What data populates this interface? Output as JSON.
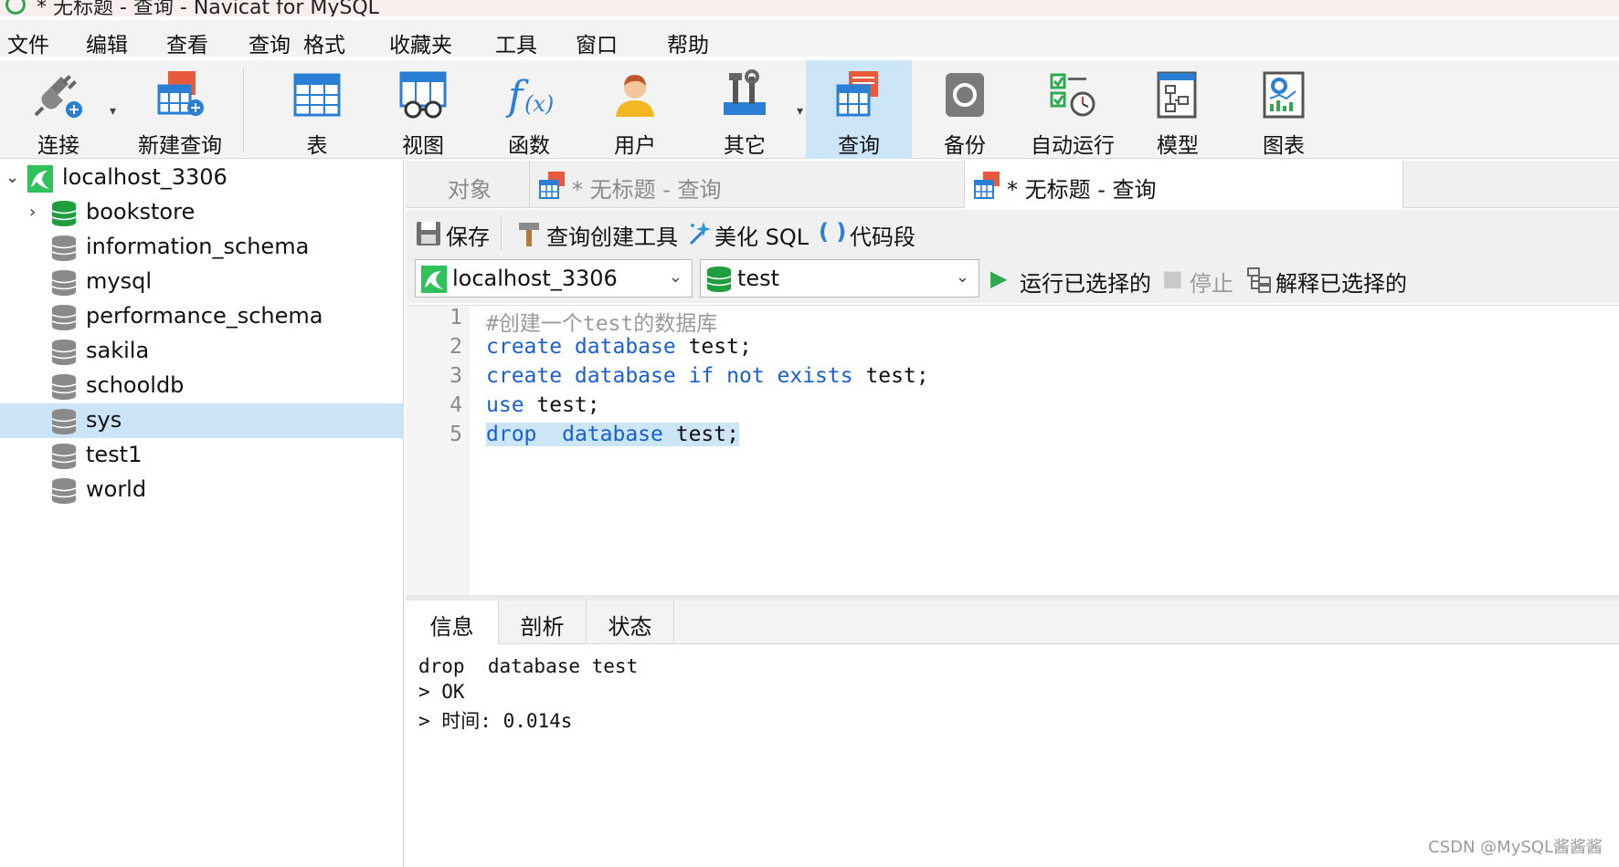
{
  "window": {
    "title": "* 无标题 - 查询 - Navicat for MySQL"
  },
  "menu": [
    "文件",
    "编辑",
    "查看",
    "查询",
    "格式",
    "收藏夹",
    "工具",
    "窗口",
    "帮助"
  ],
  "toolbar": {
    "connect": "连接",
    "new_query": "新建查询",
    "table": "表",
    "view": "视图",
    "function": "函数",
    "user": "用户",
    "other": "其它",
    "query": "查询",
    "backup": "备份",
    "auto_run": "自动运行",
    "model": "模型",
    "chart": "图表"
  },
  "tree": {
    "connection": "localhost_3306",
    "databases": [
      "bookstore",
      "information_schema",
      "mysql",
      "performance_schema",
      "sakila",
      "schooldb",
      "sys",
      "test1",
      "world"
    ],
    "selected": "sys"
  },
  "tabs": {
    "objects": "对象",
    "tab1": "* 无标题 - 查询",
    "tab2": "* 无标题 - 查询"
  },
  "query_toolbar": {
    "save": "保存",
    "query_builder": "查询创建工具",
    "beautify": "美化 SQL",
    "snippet": "代码段"
  },
  "connection_bar": {
    "connection": "localhost_3306",
    "database": "test",
    "run_selected": "运行已选择的",
    "stop": "停止",
    "explain_selected": "解释已选择的"
  },
  "editor": {
    "line_numbers": [
      "1",
      "2",
      "3",
      "4",
      "5"
    ],
    "lines": {
      "l1_comment": "#创建一个test的数据库",
      "l2_kw": "create database",
      "l2_rest": " test;",
      "l3_kw1": "create database",
      "l3_kw2": "if not exists",
      "l3_rest": " test;",
      "l4_kw": "use",
      "l4_rest": " test;",
      "l5_kw1": "drop",
      "l5_kw2": "database",
      "l5_rest": " test;"
    }
  },
  "result_tabs": {
    "info": "信息",
    "profile": "剖析",
    "status": "状态"
  },
  "output": {
    "line1": "drop  database test",
    "line2": "> OK",
    "line3": "> 时间: 0.014s"
  },
  "watermark": "CSDN @MySQL酱酱酱",
  "colors": {
    "keyword": "#1a5fd1",
    "selection": "#cde6f7",
    "navicat_green": "#2fa84f"
  }
}
